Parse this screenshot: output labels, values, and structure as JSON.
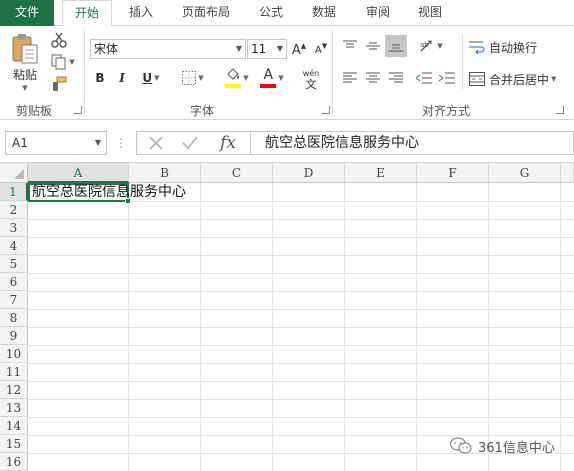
{
  "ribbon_tabs": {
    "file": "文件",
    "home": "开始",
    "insert": "插入",
    "page_layout": "页面布局",
    "formulas": "公式",
    "data": "数据",
    "review": "审阅",
    "view": "视图"
  },
  "clipboard": {
    "paste_label": "粘贴",
    "group_label": "剪贴板"
  },
  "font": {
    "name": "宋体",
    "size": "11",
    "bold": "B",
    "italic": "I",
    "underline": "U",
    "grow": "A",
    "shrink": "A",
    "font_color_letter": "A",
    "phonetic_top": "wén",
    "phonetic_bottom": "文",
    "group_label": "字体",
    "highlight_color": "#ffff00",
    "font_color": "#ff0000"
  },
  "alignment": {
    "wrap_text": "自动换行",
    "merge_center": "合并后居中",
    "group_label": "对齐方式"
  },
  "formula_bar": {
    "name_box": "A1",
    "fx": "fx",
    "content": "航空总医院信息服务中心"
  },
  "grid": {
    "columns": [
      "A",
      "B",
      "C",
      "D",
      "E",
      "F",
      "G"
    ],
    "rows": [
      "1",
      "2",
      "3",
      "4",
      "5",
      "6",
      "7",
      "8",
      "9",
      "10",
      "11",
      "12",
      "13",
      "14",
      "15",
      "16"
    ],
    "cell_a1": "航空总医院信息服务中心"
  },
  "watermark": "361信息中心",
  "accent_color": "#217346"
}
